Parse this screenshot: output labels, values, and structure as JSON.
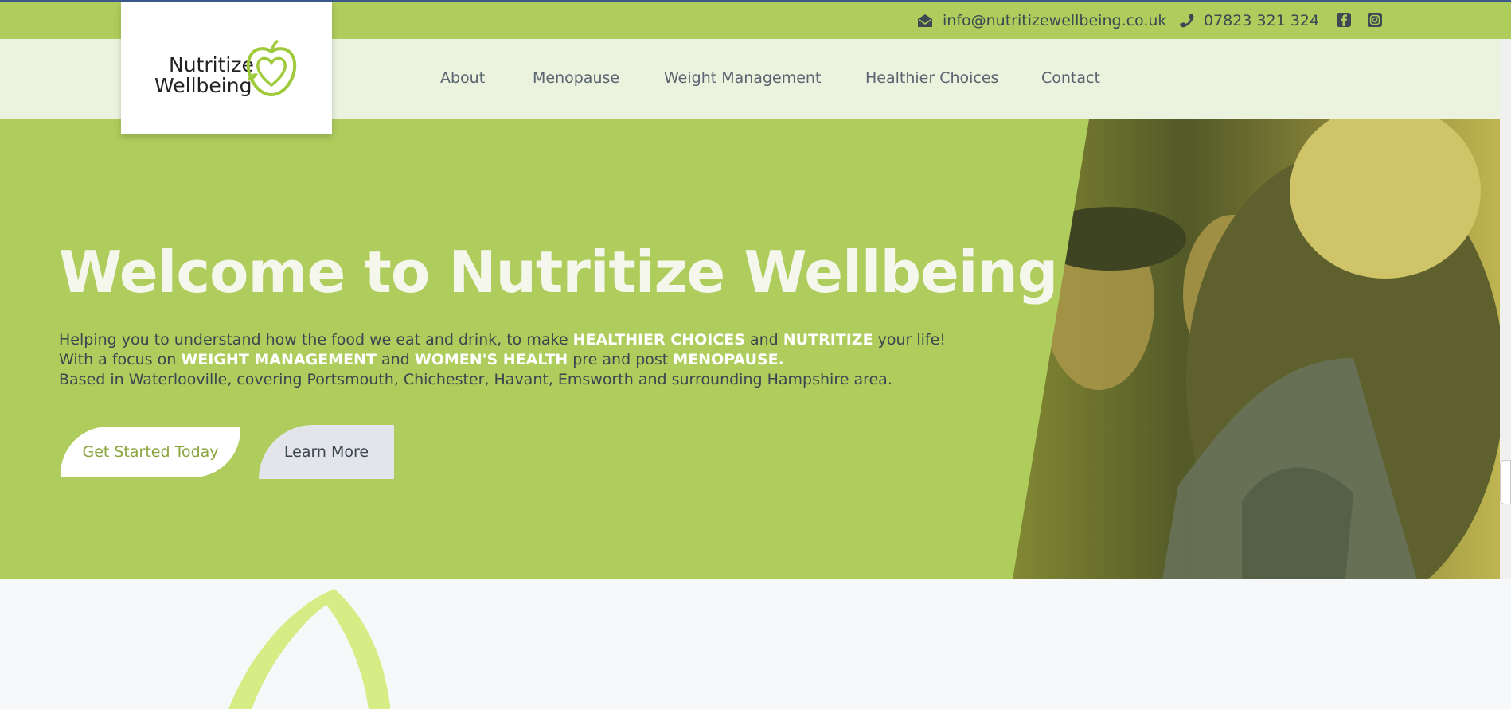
{
  "topbar": {
    "email": "info@nutritizewellbeing.co.uk",
    "phone": "07823 321 324",
    "social": [
      "facebook-icon",
      "instagram-icon"
    ]
  },
  "logo": {
    "line1": "Nutritize",
    "line2": "Wellbeing"
  },
  "nav": [
    "About",
    "Menopause",
    "Weight Management",
    "Healthier Choices",
    "Contact"
  ],
  "hero": {
    "title": "Welcome to  Nutritize Wellbeing",
    "line1_a": "Helping you to understand how the food we eat and drink, to make ",
    "line1_b": "HEALTHIER CHOICES",
    "line1_c": " and ",
    "line1_d": "NUTRITIZE",
    "line1_e": " your life!",
    "line2_a": "With a focus on ",
    "line2_b": "WEIGHT MANAGEMENT",
    "line2_c": " and ",
    "line2_d": "WOMEN'S HEALTH",
    "line2_e": " pre and post ",
    "line2_f": "MENOPAUSE.",
    "line3": "Based in Waterlooville, covering Portsmouth, Chichester, Havant, Emsworth and surrounding Hampshire area.",
    "primary_button": "Get Started Today",
    "secondary_button": "Learn More"
  },
  "colors": {
    "brand_green": "#aecd5d",
    "nav_bg": "#ebf3de",
    "leaf_green": "#d6ec84",
    "text_dark": "#3b4550"
  }
}
